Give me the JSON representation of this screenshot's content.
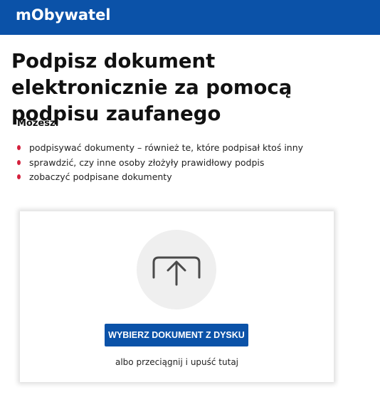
{
  "header": {
    "brand": "mObywatel",
    "bg_color": "#0b52a8"
  },
  "page": {
    "title": "Podpisz dokument elektronicznie za pomocą podpisu zaufanego",
    "can_label": "Możesz:",
    "features": [
      "podpisywać dokumenty – również te, które podpisał ktoś inny",
      "sprawdzić, czy inne osoby złożyły prawidłowy podpis",
      "zobaczyć podpisane dokumenty"
    ],
    "bullet_color": "#d4213d"
  },
  "upload": {
    "icon": "upload-icon",
    "button_label": "WYBIERZ DOKUMENT Z DYSKU",
    "hint": "albo przeciągnij i upuść tutaj"
  }
}
